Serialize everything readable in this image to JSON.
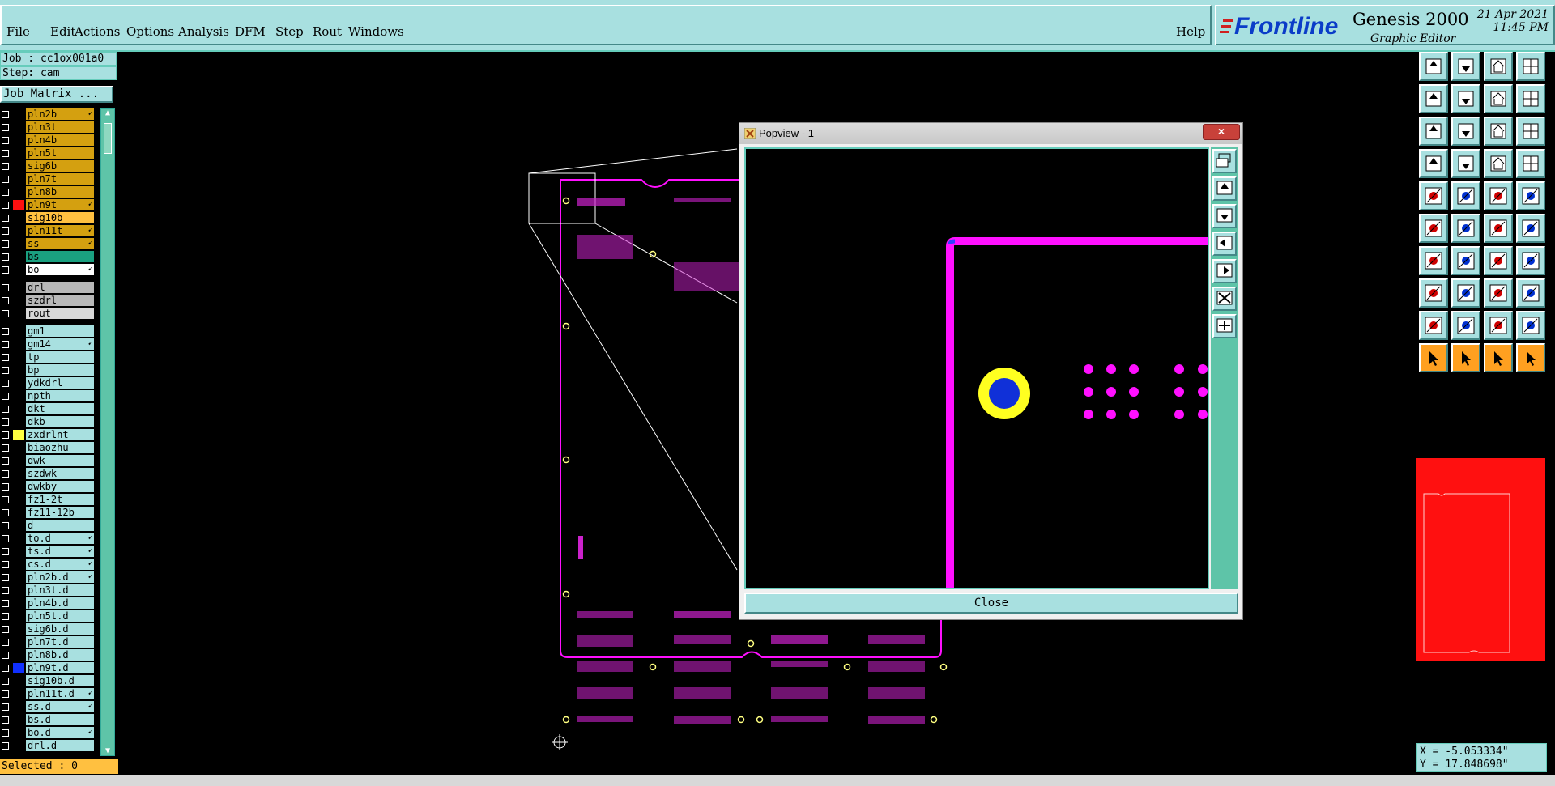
{
  "menu": {
    "items": [
      "File",
      "Edit",
      "Actions",
      "Options",
      "Analysis",
      "DFM",
      "Step",
      "Rout",
      "Windows"
    ],
    "help": "Help"
  },
  "brand": {
    "logo": "Frontline",
    "product": "Genesis 2000",
    "subtitle": "Graphic Editor",
    "date": "21 Apr 2021",
    "time": "11:45 PM"
  },
  "job": {
    "job_label": "Job : cc1ox001a0",
    "step_label": "Step: cam",
    "matrix_button": "Job Matrix ..."
  },
  "layers": [
    {
      "name": "pln2b",
      "color": "#d4a010",
      "swatch": "#000",
      "arrow": true
    },
    {
      "name": "pln3t",
      "color": "#d4a010",
      "swatch": "#000",
      "arrow": false
    },
    {
      "name": "pln4b",
      "color": "#d4a010",
      "swatch": "#000",
      "arrow": false
    },
    {
      "name": "pln5t",
      "color": "#d4a010",
      "swatch": "#000",
      "arrow": false
    },
    {
      "name": "sig6b",
      "color": "#d4a010",
      "swatch": "#000",
      "arrow": false
    },
    {
      "name": "pln7t",
      "color": "#d4a010",
      "swatch": "#000",
      "arrow": false
    },
    {
      "name": "pln8b",
      "color": "#d4a010",
      "swatch": "#000",
      "arrow": false
    },
    {
      "name": "pln9t",
      "color": "#d4a010",
      "swatch": "#ff1010",
      "arrow": true
    },
    {
      "name": "sig10b",
      "color": "#ffc040",
      "swatch": "#000",
      "arrow": false
    },
    {
      "name": "pln11t",
      "color": "#d4a010",
      "swatch": "#000",
      "arrow": true
    },
    {
      "name": "ss",
      "color": "#d4a010",
      "swatch": "#000",
      "arrow": true
    },
    {
      "name": "bs",
      "color": "#1aa080",
      "swatch": "#000",
      "arrow": false
    },
    {
      "name": "bo",
      "color": "#ffffff",
      "swatch": "#000",
      "arrow": true
    }
  ],
  "drill_layers": [
    {
      "name": "drl",
      "color": "#b8b8b8"
    },
    {
      "name": "szdrl",
      "color": "#b8b8b8"
    },
    {
      "name": "rout",
      "color": "#d8d8d8"
    }
  ],
  "misc_layers": [
    {
      "name": "gm1",
      "swatch": "#000",
      "arrow": false
    },
    {
      "name": "gm14",
      "swatch": "#000",
      "arrow": true
    },
    {
      "name": "tp",
      "swatch": "#000",
      "arrow": false
    },
    {
      "name": "bp",
      "swatch": "#000",
      "arrow": false
    },
    {
      "name": "ydkdrl",
      "swatch": "#000",
      "arrow": false
    },
    {
      "name": "npth",
      "swatch": "#000",
      "arrow": false
    },
    {
      "name": "dkt",
      "swatch": "#000",
      "arrow": false
    },
    {
      "name": "dkb",
      "swatch": "#000",
      "arrow": false
    },
    {
      "name": "zxdrlnt",
      "swatch": "#ffff40",
      "arrow": false
    },
    {
      "name": "biaozhu",
      "swatch": "#000",
      "arrow": false
    },
    {
      "name": "dwk",
      "swatch": "#000",
      "arrow": false
    },
    {
      "name": "szdwk",
      "swatch": "#000",
      "arrow": false
    },
    {
      "name": "dwkby",
      "swatch": "#000",
      "arrow": false
    },
    {
      "name": "fz1-2t",
      "swatch": "#000",
      "arrow": false
    },
    {
      "name": "fz11-12b",
      "swatch": "#000",
      "arrow": false
    },
    {
      "name": "d",
      "swatch": "#000",
      "arrow": false
    },
    {
      "name": "to.d",
      "swatch": "#000",
      "arrow": true
    },
    {
      "name": "ts.d",
      "swatch": "#000",
      "arrow": true
    },
    {
      "name": "cs.d",
      "swatch": "#000",
      "arrow": true
    },
    {
      "name": "pln2b.d",
      "swatch": "#000",
      "arrow": true
    },
    {
      "name": "pln3t.d",
      "swatch": "#000",
      "arrow": false
    },
    {
      "name": "pln4b.d",
      "swatch": "#000",
      "arrow": false
    },
    {
      "name": "pln5t.d",
      "swatch": "#000",
      "arrow": false
    },
    {
      "name": "sig6b.d",
      "swatch": "#000",
      "arrow": false
    },
    {
      "name": "pln7t.d",
      "swatch": "#000",
      "arrow": false
    },
    {
      "name": "pln8b.d",
      "swatch": "#000",
      "arrow": false
    },
    {
      "name": "pln9t.d",
      "swatch": "#1030ff",
      "arrow": false
    },
    {
      "name": "sig10b.d",
      "swatch": "#000",
      "arrow": false
    },
    {
      "name": "pln11t.d",
      "swatch": "#000",
      "arrow": true
    },
    {
      "name": "ss.d",
      "swatch": "#000",
      "arrow": true
    },
    {
      "name": "bs.d",
      "swatch": "#000",
      "arrow": false
    },
    {
      "name": "bo.d",
      "swatch": "#000",
      "arrow": true
    },
    {
      "name": "drl.d",
      "swatch": "#000",
      "arrow": false
    }
  ],
  "status": {
    "selected": "Selected : 0",
    "x": "X = -5.053334\"",
    "y": "Y = 17.848698\""
  },
  "popview": {
    "title": "Popview - 1",
    "close_label": "Close",
    "close_x": "×"
  },
  "toolbar_icons": [
    "open-job-icon",
    "save-icon",
    "home-icon",
    "layout-icon",
    "prev-icon",
    "next-icon",
    "undo-icon",
    "redo-icon",
    "zoom-fit-icon",
    "pan-icon",
    "scale-1-2-icon",
    "help-icon",
    "eye-icon",
    "snap-icon",
    "filter-icon",
    "filter2-icon",
    "pad-icon",
    "line-icon",
    "measure-icon",
    "dot-icon",
    "net-icon",
    "cross-icon",
    "connect-icon",
    "connect2-icon",
    "angle-icon",
    "slope-icon",
    "arc-icon",
    "text-f-icon",
    "select-rect-icon",
    "line-minus-icon",
    "box-plus-icon",
    "grid-icon",
    "triangle-icon",
    "triangle2-icon",
    "triangle3-icon",
    "triangle4-icon",
    "pointer-icon",
    "pointer2-icon",
    "pointer3-icon",
    "pointer4-icon"
  ],
  "colors": {
    "panel": "#a8e0e0",
    "magenta": "#ff10ff",
    "gold": "#d4a010",
    "red": "#ff1010"
  }
}
